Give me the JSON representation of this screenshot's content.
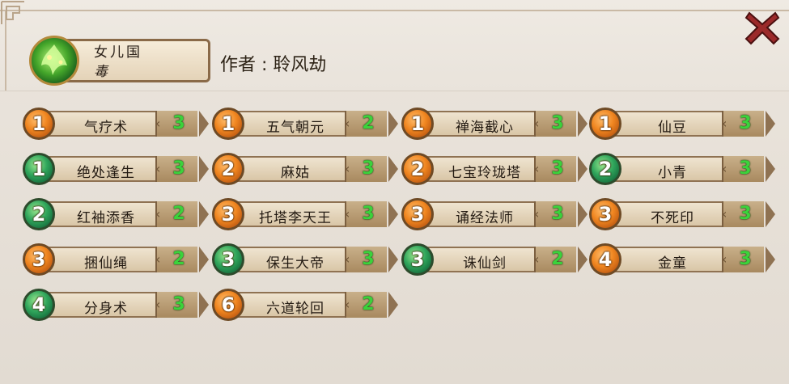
{
  "header": {
    "hero_name": "女儿国",
    "hero_type": "毒",
    "author_label": "作者 : 聆风劫"
  },
  "colors": {
    "orb_orange": "#f08620",
    "orb_green": "#2fa55b",
    "count_green": "#3bd23b",
    "close_red": "#9b2a2a"
  },
  "icons": {
    "close": "close-x-icon",
    "hero": "hero-portrait-icon"
  },
  "cards": [
    {
      "cost": "1",
      "orb": "orange",
      "name": "气疗术",
      "count": "3"
    },
    {
      "cost": "1",
      "orb": "orange",
      "name": "五气朝元",
      "count": "2"
    },
    {
      "cost": "1",
      "orb": "orange",
      "name": "禅海截心",
      "count": "3"
    },
    {
      "cost": "1",
      "orb": "orange",
      "name": "仙豆",
      "count": "3"
    },
    {
      "cost": "1",
      "orb": "green",
      "name": "绝处逢生",
      "count": "3"
    },
    {
      "cost": "2",
      "orb": "orange",
      "name": "麻姑",
      "count": "3"
    },
    {
      "cost": "2",
      "orb": "orange",
      "name": "七宝玲珑塔",
      "count": "3"
    },
    {
      "cost": "2",
      "orb": "green",
      "name": "小青",
      "count": "3"
    },
    {
      "cost": "2",
      "orb": "green",
      "name": "红袖添香",
      "count": "2"
    },
    {
      "cost": "3",
      "orb": "orange",
      "name": "托塔李天王",
      "count": "3"
    },
    {
      "cost": "3",
      "orb": "orange",
      "name": "诵经法师",
      "count": "3"
    },
    {
      "cost": "3",
      "orb": "orange",
      "name": "不死印",
      "count": "3"
    },
    {
      "cost": "3",
      "orb": "orange",
      "name": "捆仙绳",
      "count": "2"
    },
    {
      "cost": "3",
      "orb": "green",
      "name": "保生大帝",
      "count": "3"
    },
    {
      "cost": "3",
      "orb": "green",
      "name": "诛仙剑",
      "count": "2"
    },
    {
      "cost": "4",
      "orb": "orange",
      "name": "金童",
      "count": "3"
    },
    {
      "cost": "4",
      "orb": "green",
      "name": "分身术",
      "count": "3"
    },
    {
      "cost": "6",
      "orb": "orange",
      "name": "六道轮回",
      "count": "2"
    }
  ]
}
